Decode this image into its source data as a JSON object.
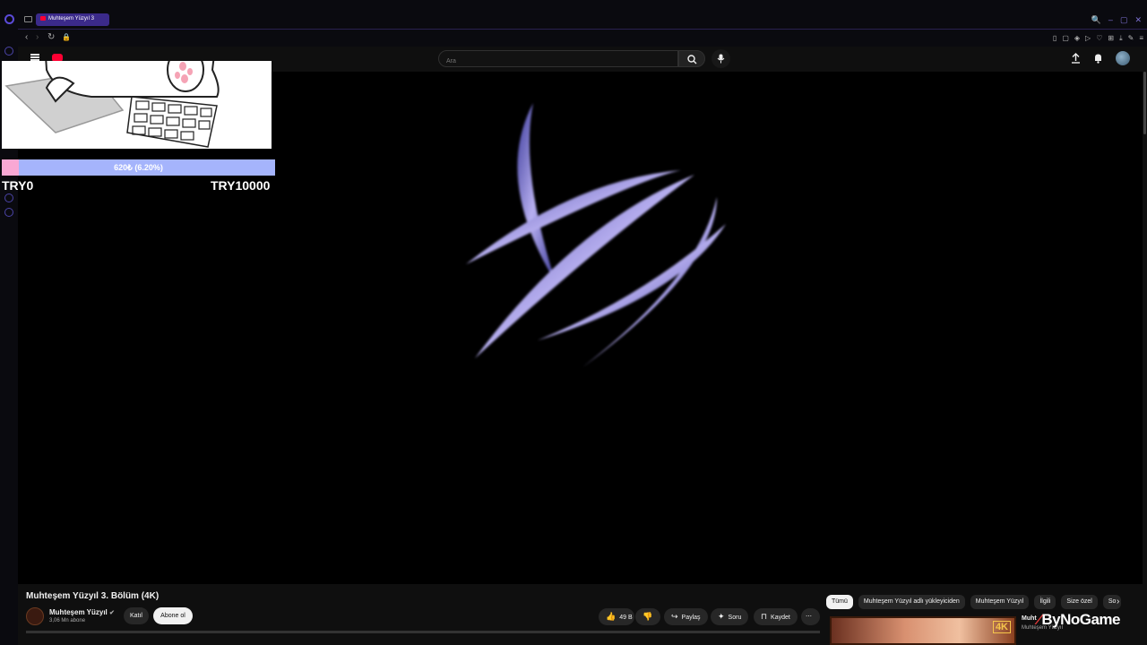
{
  "browser": {
    "tab_title": "Muhteşem Yüzyıl 3",
    "window_controls": [
      "🔍",
      "–",
      "▢",
      "✕"
    ]
  },
  "header": {
    "search_placeholder": "Ara"
  },
  "overlay": {
    "donation_label": "620₺ (6.20%)",
    "donation_fraction": 0.062,
    "min_label": "TRY0",
    "max_label": "TRY10000"
  },
  "video": {
    "title": "Muhteşem Yüzyıl 3. Bölüm (4K)"
  },
  "channel": {
    "name": "Muhteşem Yüzyıl",
    "subscribers": "3,06 Mn abone",
    "join_label": "Katıl",
    "subscribe_label": "Abone ol"
  },
  "actions": {
    "likes": "49 B",
    "share": "Paylaş",
    "ask": "Soru",
    "save": "Kaydet"
  },
  "chips": [
    "Tümü",
    "Muhteşem Yüzyıl adlı yükleyiciden",
    "Muhteşem Yüzyıl",
    "İlgili",
    "Size özel",
    "So"
  ],
  "recommendation": {
    "title": "Muht",
    "channel": "Muhteşem Yüzyıl",
    "badge": "4K"
  },
  "watermark": "ByNoGame",
  "colors": {
    "accent": "#3b2a8a",
    "youtube_red": "#ff0033",
    "donation_fill": "#f9a8d4",
    "donation_bg": "#a5b4fc"
  }
}
